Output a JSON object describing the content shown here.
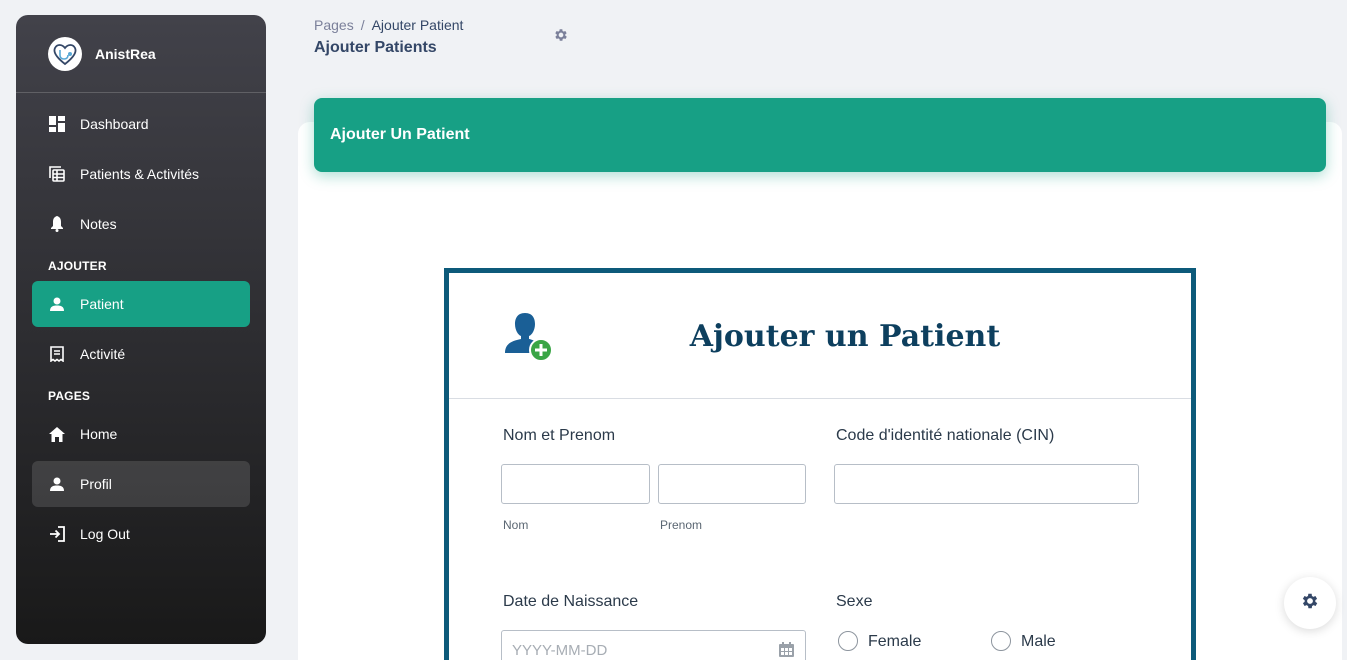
{
  "sidebar": {
    "brand": "AnistRea",
    "items": [
      {
        "label": "Dashboard",
        "icon": "dashboard-icon"
      },
      {
        "label": "Patients & Activités",
        "icon": "table-icon"
      },
      {
        "label": "Notes",
        "icon": "bell-icon"
      }
    ],
    "section_add": "AJOUTER",
    "add_items": [
      {
        "label": "Patient",
        "icon": "person-icon",
        "active": true
      },
      {
        "label": "Activité",
        "icon": "receipt-icon"
      }
    ],
    "section_pages": "PAGES",
    "page_items": [
      {
        "label": "Home",
        "icon": "home-icon"
      },
      {
        "label": "Profil",
        "icon": "person-icon"
      },
      {
        "label": "Log Out",
        "icon": "logout-icon"
      }
    ]
  },
  "header": {
    "breadcrumb_root": "Pages",
    "breadcrumb_sep": "/",
    "breadcrumb_current": "Ajouter Patient",
    "title": "Ajouter Patients"
  },
  "card": {
    "header_title": "Ajouter Un Patient"
  },
  "form": {
    "title": "Ajouter un Patient",
    "name_label": "Nom et Prenom",
    "nom_sublabel": "Nom",
    "prenom_sublabel": "Prenom",
    "nom_value": "",
    "prenom_value": "",
    "cin_label": "Code d'identité nationale (CIN)",
    "cin_value": "",
    "dob_label": "Date de Naissance",
    "dob_placeholder": "YYYY-MM-DD",
    "sex_label": "Sexe",
    "sex_options": [
      "Female",
      "Male"
    ]
  },
  "colors": {
    "accent": "#17a085",
    "form_border": "#0d5a7a",
    "form_title": "#0d3f5e"
  }
}
